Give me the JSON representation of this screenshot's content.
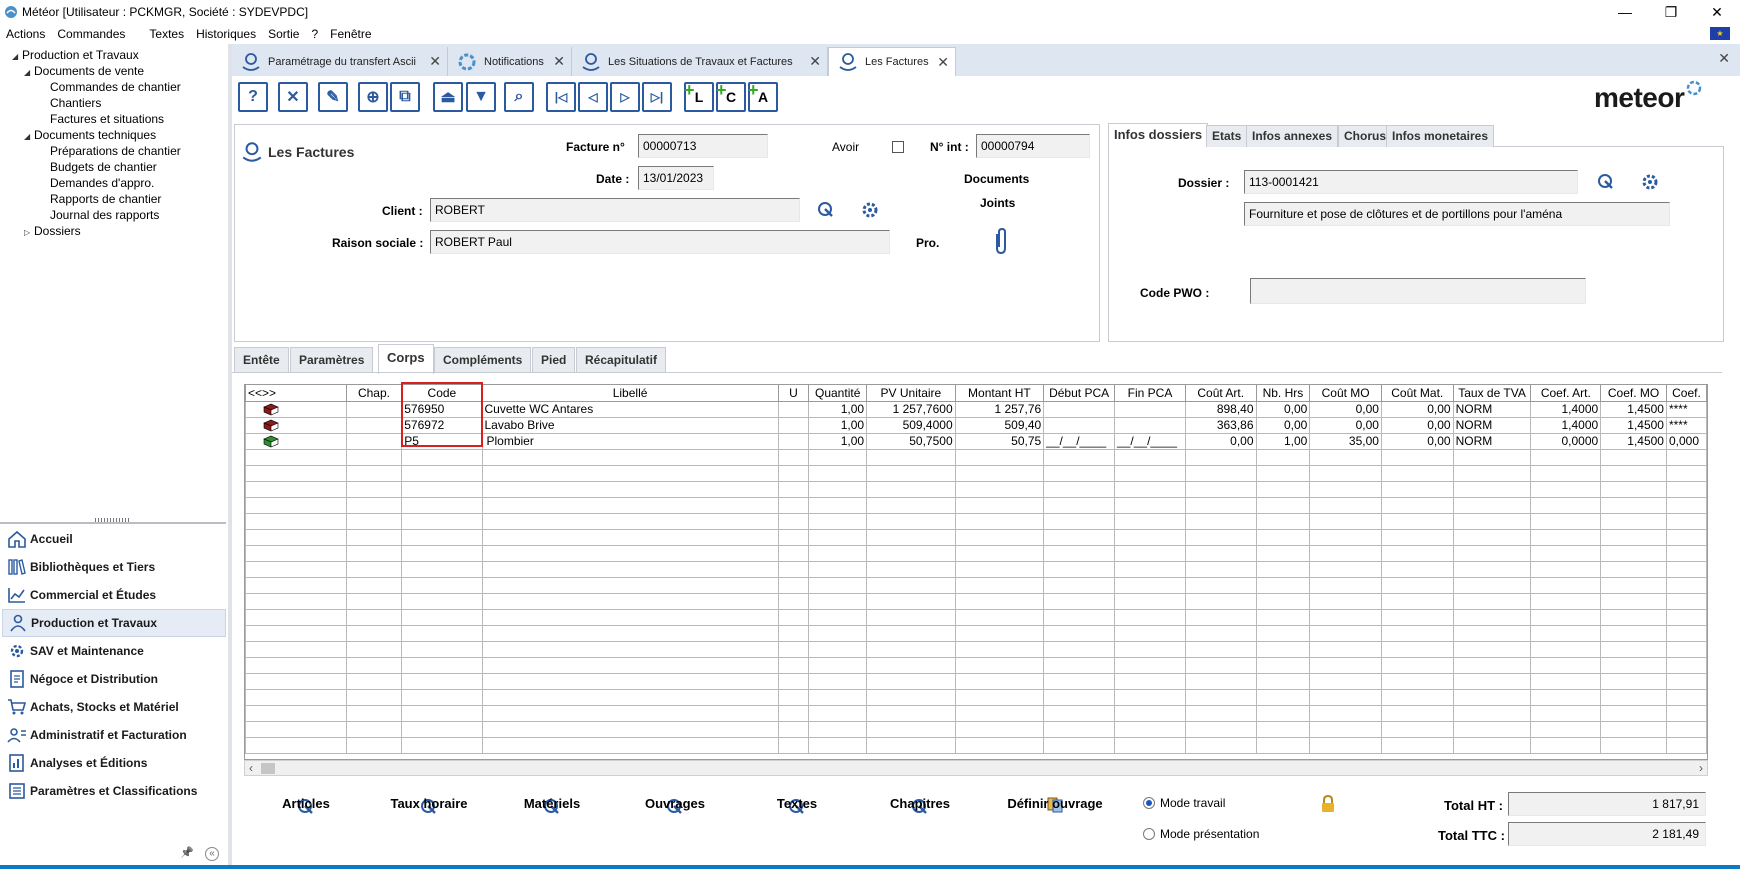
{
  "window": {
    "title": "Météor [Utilisateur : PCKMGR, Société : SYDEVPDC]",
    "controls": [
      "—",
      "❐",
      "✕"
    ]
  },
  "menu": [
    "Actions",
    "Commandes",
    "Textes",
    "Historiques",
    "Sortie",
    "?",
    "Fenêtre"
  ],
  "tree": [
    {
      "label": "Production et Travaux",
      "level": 0,
      "state": "expanded"
    },
    {
      "label": "Documents de vente",
      "level": 1,
      "state": "expanded"
    },
    {
      "label": "Commandes de chantier",
      "level": 2,
      "state": "leaf"
    },
    {
      "label": "Chantiers",
      "level": 2,
      "state": "leaf"
    },
    {
      "label": "Factures et situations",
      "level": 2,
      "state": "leaf"
    },
    {
      "label": "Documents techniques",
      "level": 1,
      "state": "expanded"
    },
    {
      "label": "Préparations de chantier",
      "level": 2,
      "state": "leaf"
    },
    {
      "label": "Budgets de chantier",
      "level": 2,
      "state": "leaf"
    },
    {
      "label": "Demandes d'appro.",
      "level": 2,
      "state": "leaf"
    },
    {
      "label": "Rapports de chantier",
      "level": 2,
      "state": "leaf"
    },
    {
      "label": "Journal des rapports",
      "level": 2,
      "state": "leaf"
    },
    {
      "label": "Dossiers",
      "level": 1,
      "state": "collapsed"
    }
  ],
  "nav": [
    {
      "label": "Accueil",
      "icon": "home-icon"
    },
    {
      "label": "Bibliothèques et Tiers",
      "icon": "library-icon"
    },
    {
      "label": "Commercial et Études",
      "icon": "chart-icon"
    },
    {
      "label": "Production et Travaux",
      "icon": "worker-icon",
      "active": true
    },
    {
      "label": "SAV et Maintenance",
      "icon": "gear-icon"
    },
    {
      "label": "Négoce et Distribution",
      "icon": "document-icon"
    },
    {
      "label": "Achats, Stocks et Matériel",
      "icon": "cart-icon"
    },
    {
      "label": "Administratif et Facturation",
      "icon": "admin-icon"
    },
    {
      "label": "Analyses et Éditions",
      "icon": "analysis-icon"
    },
    {
      "label": "Paramètres et Classifications",
      "icon": "settings-icon"
    }
  ],
  "nav_footer": {
    "pin": "📌",
    "collapse": "«"
  },
  "doc_tabs": [
    {
      "label": "Paramétrage du transfert Ascii",
      "active": false
    },
    {
      "label": "Notifications",
      "active": false
    },
    {
      "label": "Les Situations de Travaux et Factures",
      "active": false
    },
    {
      "label": "Les Factures",
      "active": true
    }
  ],
  "toolbar": {
    "buttons": [
      "?",
      "✕",
      "✎",
      "⊕",
      "⧉",
      "⏏",
      "▼",
      "⌕",
      "|◁",
      "◁",
      "▷",
      "▷|"
    ],
    "plus_buttons": [
      "L",
      "C",
      "A"
    ],
    "brand": "meteor"
  },
  "header": {
    "section_title": "Les Factures",
    "facture_label": "Facture n°",
    "facture_value": "00000713",
    "avoir_label": "Avoir",
    "nint_label": "N° int :",
    "nint_value": "00000794",
    "date_label": "Date :",
    "date_value": "13/01/2023",
    "documents_label": "Documents",
    "joints_label": "Joints",
    "client_label": "Client :",
    "client_value": "ROBERT",
    "raison_label": "Raison sociale :",
    "raison_value": "ROBERT Paul",
    "pro_label": "Pro."
  },
  "right_panel": {
    "tabs": [
      "Infos dossiers",
      "Etats",
      "Infos annexes",
      "Chorus",
      "Infos monetaires"
    ],
    "dossier_label": "Dossier :",
    "dossier_value": "113-0001421",
    "dossier_desc": "Fourniture et pose de clôtures et de portillons pour l'aména",
    "code_pwo_label": "Code PWO :",
    "code_pwo_value": ""
  },
  "sub_tabs": [
    {
      "label": "Entête",
      "active": false
    },
    {
      "label": "Paramètres",
      "active": false
    },
    {
      "label": "Corps",
      "active": true
    },
    {
      "label": "Compléments",
      "active": false
    },
    {
      "label": "Pied",
      "active": false
    },
    {
      "label": "Récapitulatif",
      "active": false
    }
  ],
  "grid": {
    "nav_label": "<<>>",
    "columns": [
      "",
      "Chap.",
      "Code",
      "Libellé",
      "U",
      "Quantité",
      "PV Unitaire",
      "Montant HT",
      "Début PCA",
      "Fin PCA",
      "Coût Art.",
      "Nb. Hrs",
      "Coût MO",
      "Coût Mat.",
      "Taux de TVA",
      "Coef. Art.",
      "Coef. MO",
      "Coef."
    ],
    "rows": [
      {
        "icon": "book-red",
        "chap": "",
        "code": "576950",
        "libelle": "Cuvette WC Antares",
        "u": "",
        "qte": "1,00",
        "pvu": "1 257,7600",
        "mht": "1 257,76",
        "debut": "",
        "fin": "",
        "cart": "898,40",
        "nbh": "0,00",
        "cmo": "0,00",
        "cmat": "0,00",
        "tva": "NORM",
        "coefart": "1,4000",
        "coefmo": "1,4500",
        "coef": "****"
      },
      {
        "icon": "book-red",
        "chap": "",
        "code": "576972",
        "libelle": "Lavabo Brive",
        "u": "",
        "qte": "1,00",
        "pvu": "509,4000",
        "mht": "509,40",
        "debut": "",
        "fin": "",
        "cart": "363,86",
        "nbh": "0,00",
        "cmo": "0,00",
        "cmat": "0,00",
        "tva": "NORM",
        "coefart": "1,4000",
        "coefmo": "1,4500",
        "coef": "****"
      },
      {
        "icon": "book-green",
        "chap": "",
        "code": "P5",
        "libelle": "Plombier",
        "u": "",
        "qte": "1,00",
        "pvu": "50,7500",
        "mht": "50,75",
        "debut": "__/__/____",
        "fin": "__/__/____",
        "cart": "0,00",
        "nbh": "1,00",
        "cmo": "35,00",
        "cmat": "0,00",
        "tva": "NORM",
        "coefart": "0,0000",
        "coefmo": "1,4500",
        "coef": "0,000"
      }
    ],
    "empty_rows": 19
  },
  "bottom": {
    "actions": [
      "Articles",
      "Taux horaire",
      "Matériels",
      "Ouvrages",
      "Textes",
      "Chapitres",
      "Définir ouvrage"
    ],
    "mode_travail": "Mode travail",
    "mode_presentation": "Mode présentation",
    "total_ht_label": "Total HT :",
    "total_ht_value": "1 817,91",
    "total_ttc_label": "Total TTC :",
    "total_ttc_value": "2 181,49"
  }
}
